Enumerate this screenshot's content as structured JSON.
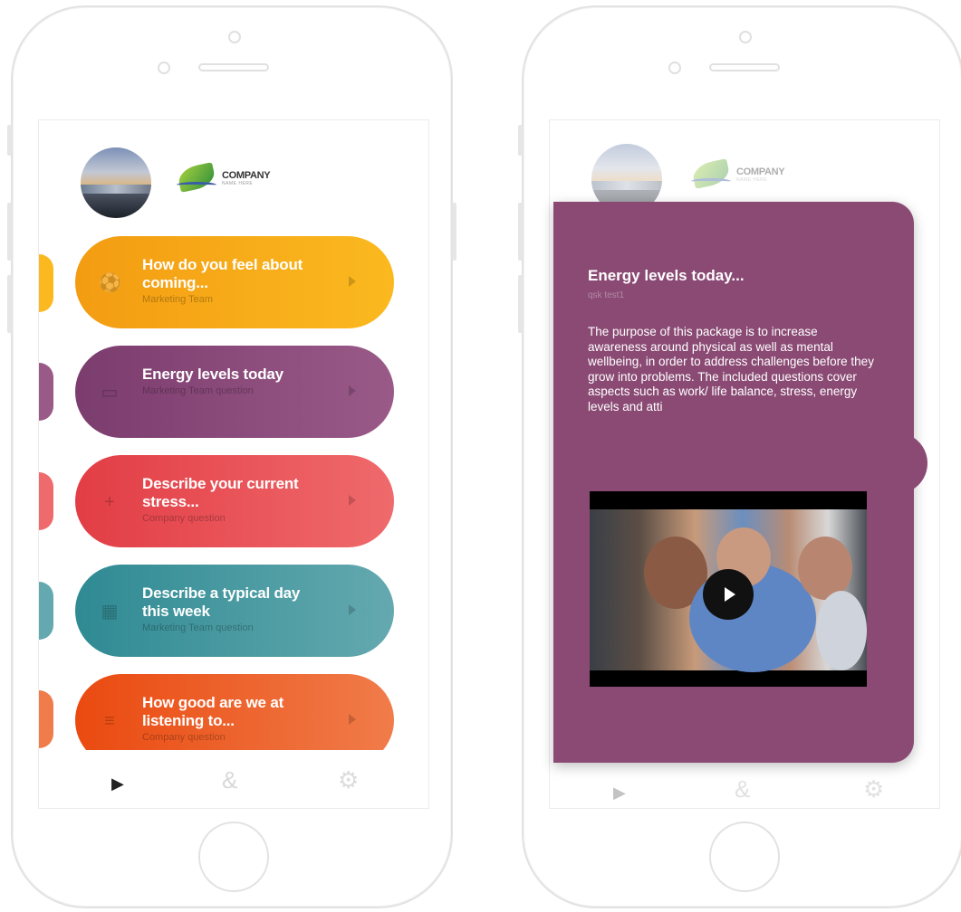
{
  "left_screen": {
    "logo": {
      "name": "COMPANY",
      "tagline": "NAME HERE"
    },
    "questions": [
      {
        "title": "How do you feel about coming...",
        "subtitle": "Marketing Team",
        "icon": "soccer-ball-icon",
        "color_start": "#f39c12",
        "color_end": "#fbb91f"
      },
      {
        "title": "Energy levels today",
        "subtitle": "Marketing Team question",
        "icon": "battery-icon",
        "color_start": "#7b3c6e",
        "color_end": "#9a5a88"
      },
      {
        "title": "Describe your current stress...",
        "subtitle": "Company question",
        "icon": "plus-icon",
        "color_start": "#e23d45",
        "color_end": "#ef6a6c"
      },
      {
        "title": "Describe a typical day this week",
        "subtitle": "Marketing Team question",
        "icon": "grid-icon",
        "color_start": "#2f8a93",
        "color_end": "#64a9af"
      },
      {
        "title": "How good are we at listening to...",
        "subtitle": "Company question",
        "icon": "sliders-icon",
        "color_start": "#ea4a10",
        "color_end": "#f07c4a"
      }
    ],
    "tabs": [
      {
        "label": "▶",
        "icon": "play-icon",
        "color": "#222222"
      },
      {
        "label": "&",
        "icon": "ampersand-icon",
        "color": "#d8d8d8"
      },
      {
        "label": "⚙",
        "icon": "gear-icon",
        "color": "#dcdcdc"
      }
    ]
  },
  "right_screen": {
    "logo": {
      "name": "COMPANY",
      "tagline": "NAME HERE"
    },
    "detail": {
      "title": "Energy levels today...",
      "subtitle": "qsk test1",
      "description": "The purpose of this package is to increase awareness around physical as well as mental wellbeing, in order to address challenges before they grow into problems.  The included questions cover aspects such as work/ life balance, stress, energy levels and atti",
      "accent_color": "#8a4a74"
    },
    "tabs": [
      {
        "label": "▶",
        "icon": "play-icon"
      },
      {
        "label": "&",
        "icon": "ampersand-icon"
      },
      {
        "label": "⚙",
        "icon": "gear-icon"
      }
    ]
  }
}
